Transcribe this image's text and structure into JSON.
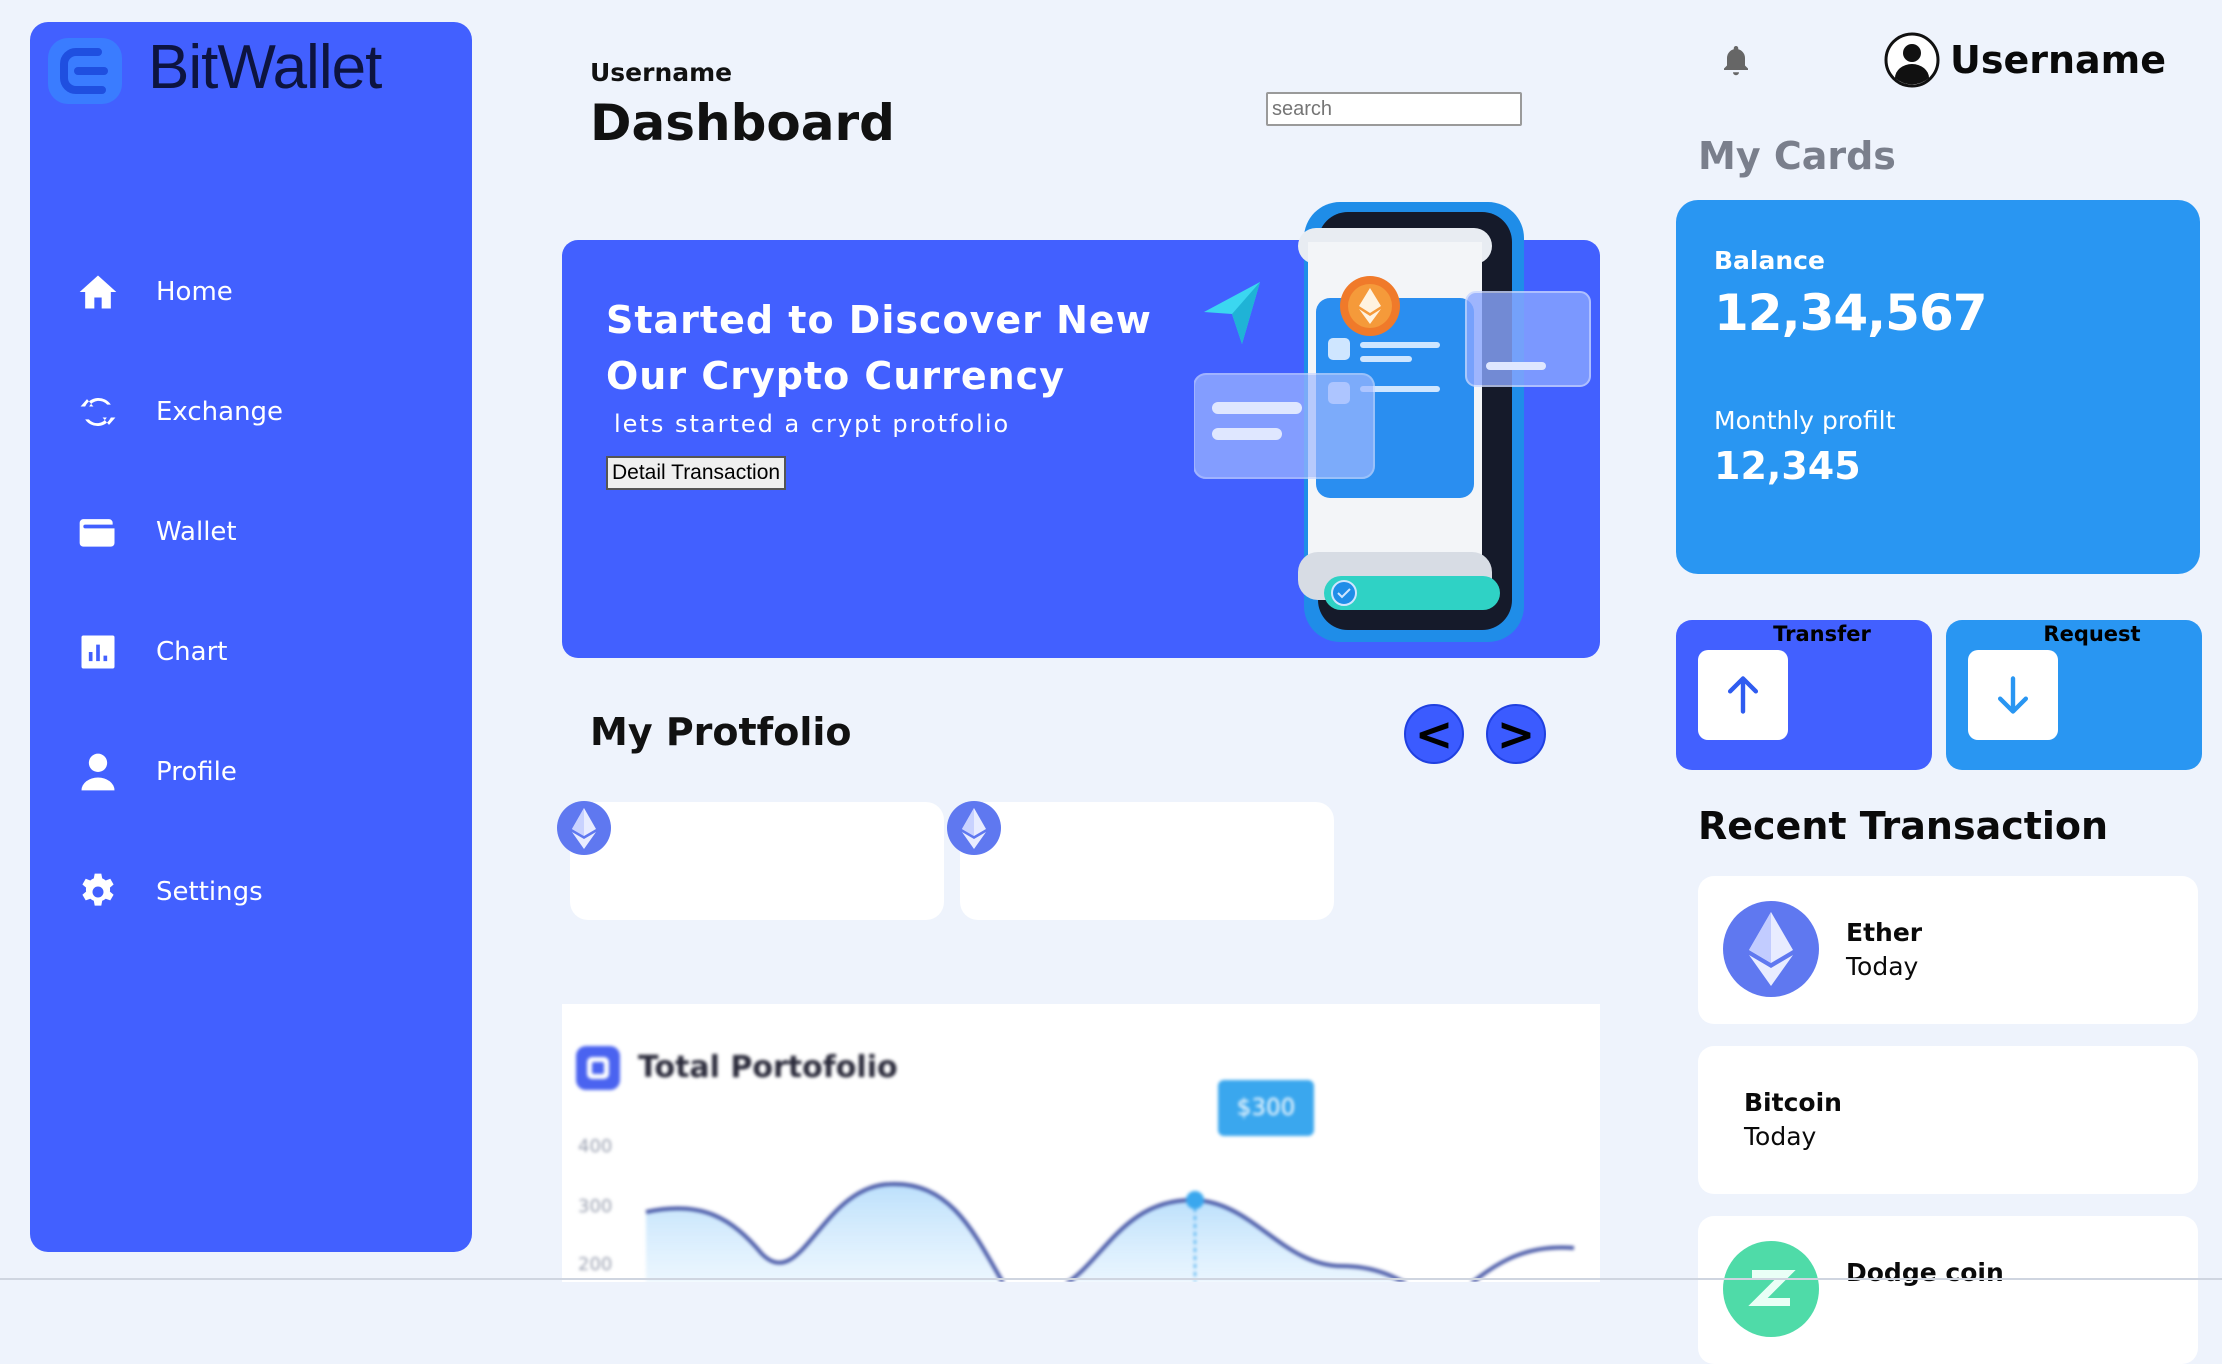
{
  "brand": {
    "name": "BitWallet"
  },
  "sidebar": {
    "items": [
      {
        "label": "Home",
        "icon": "home-icon"
      },
      {
        "label": "Exchange",
        "icon": "refresh-icon"
      },
      {
        "label": "Wallet",
        "icon": "wallet-icon"
      },
      {
        "label": "Chart",
        "icon": "bar-chart-icon"
      },
      {
        "label": "Profile",
        "icon": "user-icon"
      },
      {
        "label": "Settings",
        "icon": "gear-icon"
      }
    ]
  },
  "header": {
    "subtitle": "Username",
    "title": "Dashboard",
    "search_placeholder": "search",
    "user_name": "Username"
  },
  "banner": {
    "heading": "Started to Discover New Our Crypto Currency",
    "subheading": "lets started a crypt protfolio",
    "button_label": "Detail Transaction"
  },
  "portfolio": {
    "title": "My Protfolio",
    "prev_label": "<",
    "next_label": ">",
    "cards": [
      {
        "icon": "ethereum-icon"
      },
      {
        "icon": "ethereum-icon"
      }
    ]
  },
  "total_portfolio": {
    "title": "Total Portofolio",
    "tooltip": "$300",
    "y_ticks": [
      "400",
      "300",
      "200"
    ]
  },
  "chart_data": {
    "type": "area",
    "title": "Total Portofolio",
    "y_ticks": [
      400,
      300,
      200
    ],
    "highlight": {
      "label": "$300",
      "value": 300
    }
  },
  "my_cards": {
    "title": "My Cards",
    "balance_label": "Balance",
    "balance_value": "12,34,567",
    "profit_label": "Monthly profilt",
    "profit_value": "12,345"
  },
  "actions": {
    "transfer_label": "Transfer",
    "request_label": "Request"
  },
  "recent": {
    "title": "Recent Transaction",
    "items": [
      {
        "name": "Ether",
        "time": "Today"
      },
      {
        "name": "Bitcoin",
        "time": "Today"
      },
      {
        "name": "Dodge coin",
        "time": ""
      }
    ]
  },
  "colors": {
    "primary": "#4260ff",
    "card_blue": "#2996f2",
    "background": "#eef3fc"
  }
}
